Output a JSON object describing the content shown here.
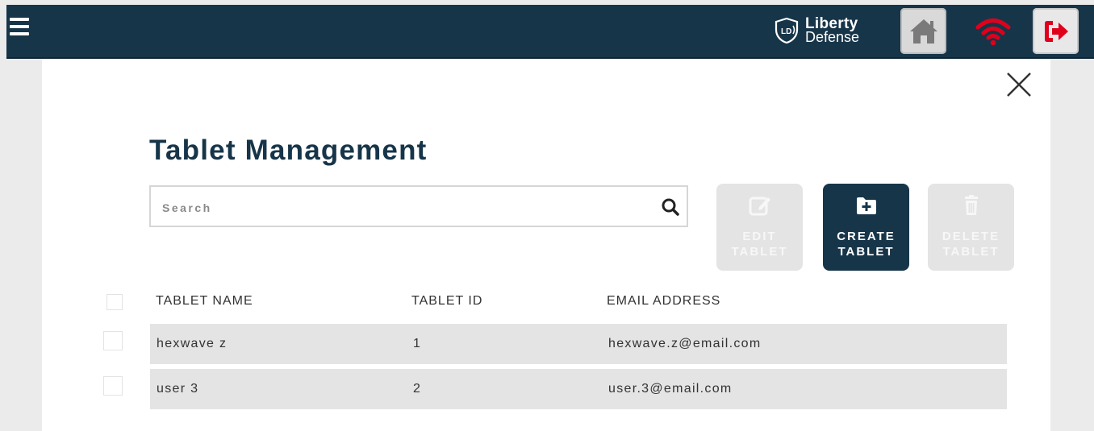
{
  "topbar": {
    "logo_line1": "Liberty",
    "logo_line2": "Defense",
    "logo_mark": "LD",
    "bg_color": "#173549",
    "wifi_color": "#e0001b",
    "logout_color": "#e0001b"
  },
  "page": {
    "title": "Tablet Management",
    "search_placeholder": "Search"
  },
  "actions": {
    "edit_line1": "EDIT",
    "edit_line2": "TABLET",
    "create_line1": "CREATE",
    "create_line2": "TABLET",
    "delete_line1": "DELETE",
    "delete_line2": "TABLET"
  },
  "table": {
    "headers": [
      "TABLET NAME",
      "TABLET ID",
      "EMAIL ADDRESS"
    ],
    "rows": [
      {
        "name": "hexwave z",
        "id": "1",
        "email": "hexwave.z@email.com"
      },
      {
        "name": "user 3",
        "id": "2",
        "email": "user.3@email.com"
      }
    ]
  }
}
